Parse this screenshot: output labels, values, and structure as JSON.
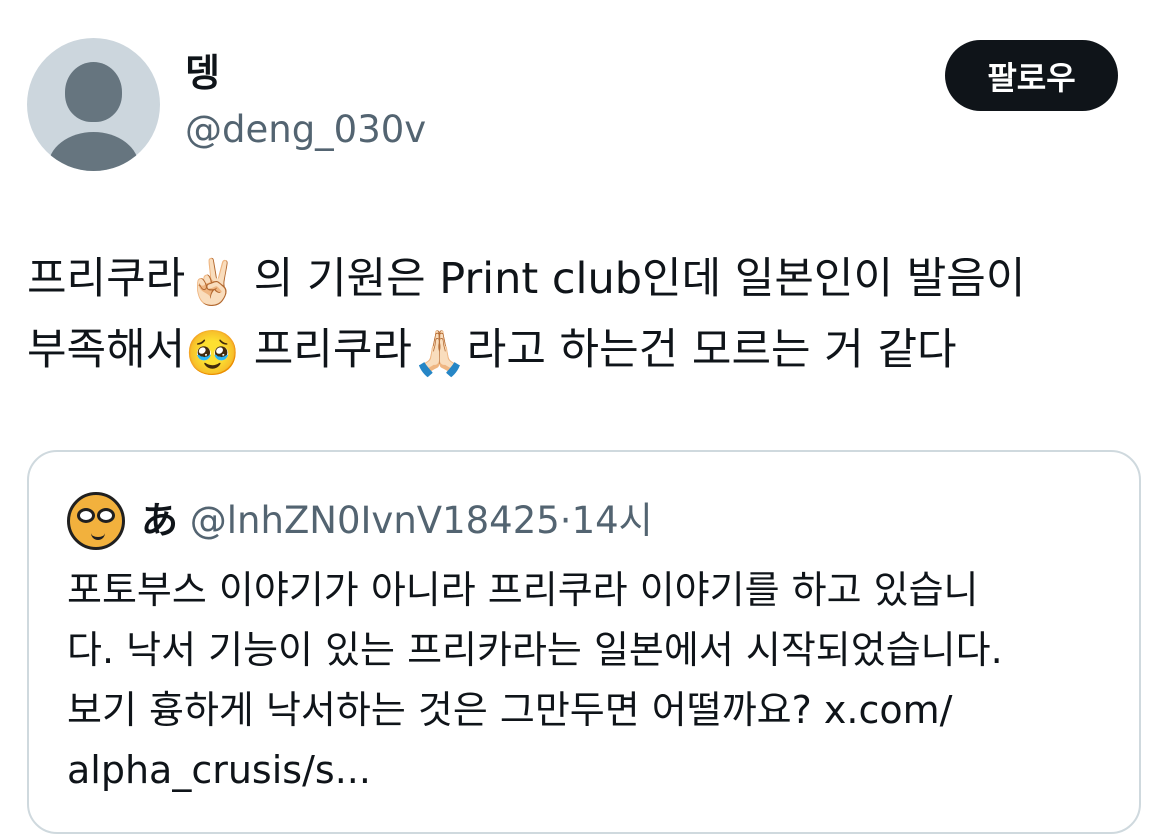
{
  "author": {
    "display_name": "뎅",
    "handle": "@deng_030v"
  },
  "follow_button": {
    "label": "팔로우"
  },
  "tweet": {
    "line1_a": "프리쿠라",
    "emoji_victory": "✌🏻",
    "line1_b": " 의 기원은 Print club인데 일본인이 발음이",
    "line2_a": "부족해서",
    "emoji_pleading": "🥹",
    "line2_b": " 프리쿠라",
    "emoji_pray": "🙏🏻",
    "line2_c": "라고 하는건 모르는 거 같다"
  },
  "quote": {
    "name": "あ",
    "handle": "@lnhZN0IvnV18425",
    "dot": "·",
    "time": "14시",
    "lines": [
      "포토부스 이야기가 아니라 프리쿠라 이야기를 하고 있습니",
      "다. 낙서 기능이 있는 프리카라는 일본에서 시작되었습니다.",
      "보기 흉하게 낙서하는 것은 그만두면 어떨까요? x.com/",
      "alpha_crusis/s..."
    ]
  },
  "colors": {
    "text_primary": "#0f1419",
    "text_secondary": "#536471",
    "border": "#cfd9de",
    "button_bg": "#0f1419"
  }
}
